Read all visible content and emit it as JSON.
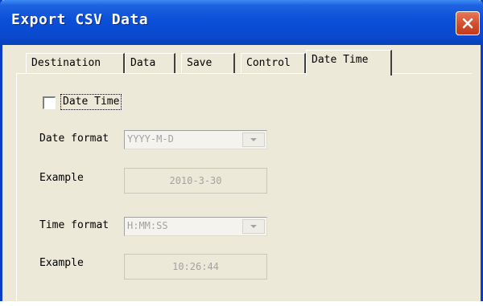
{
  "window": {
    "title": "Export CSV Data"
  },
  "tabs": [
    {
      "label": "Destination"
    },
    {
      "label": "Data"
    },
    {
      "label": "Save"
    },
    {
      "label": "Control"
    },
    {
      "label": "Date Time",
      "active": true
    }
  ],
  "date_time": {
    "checkbox_label": "Date Time",
    "checked": false,
    "date_format_label": "Date format",
    "date_format_value": "YYYY-M-D",
    "date_example_label": "Example",
    "date_example_value": "2010-3-30",
    "time_format_label": "Time format",
    "time_format_value": "H:MM:SS",
    "time_example_label": "Example",
    "time_example_value": "10:26:44"
  },
  "colors": {
    "titlebar": "#0b4fd8",
    "close_button": "#d24e2b",
    "dialog_bg": "#ece9d8",
    "disabled_text": "#a3a3a3"
  }
}
